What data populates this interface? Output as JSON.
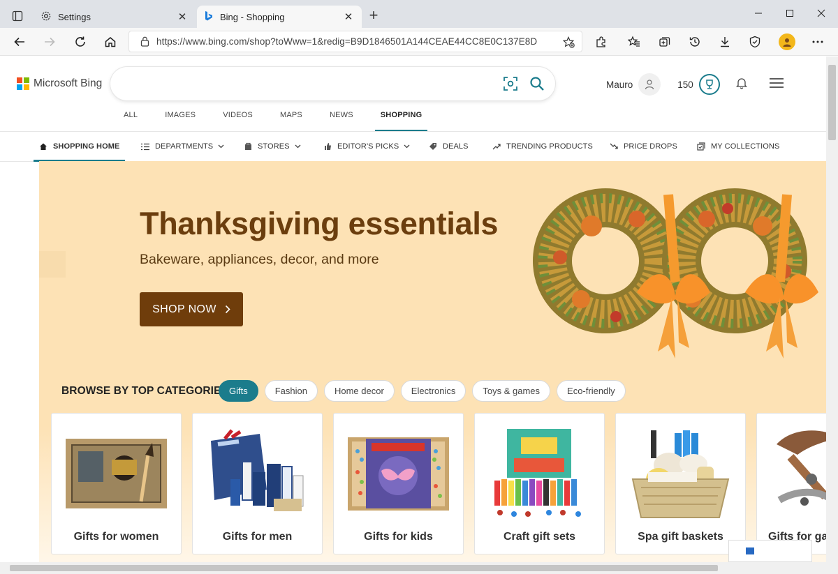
{
  "browser": {
    "tabs": [
      {
        "title": "Settings",
        "icon": "gear-icon"
      },
      {
        "title": "Bing - Shopping",
        "icon": "bing-icon"
      }
    ],
    "url": "https://www.bing.com/shop?toWww=1&redig=B9D1846501A144CEAE44CC8E0C137E8D"
  },
  "header": {
    "logo_text": "Microsoft Bing",
    "search_value": "",
    "user_name": "Mauro",
    "reward_points": "150"
  },
  "scopes": [
    "ALL",
    "IMAGES",
    "VIDEOS",
    "MAPS",
    "NEWS",
    "SHOPPING"
  ],
  "category_nav": [
    {
      "label": "SHOPPING HOME",
      "icon": "home-icon"
    },
    {
      "label": "DEPARTMENTS",
      "icon": "list-icon"
    },
    {
      "label": "STORES",
      "icon": "store-icon"
    },
    {
      "label": "EDITOR'S PICKS",
      "icon": "thumbs-up-icon"
    },
    {
      "label": "DEALS",
      "icon": "tag-icon"
    },
    {
      "label": "TRENDING PRODUCTS",
      "icon": "trending-icon"
    },
    {
      "label": "PRICE DROPS",
      "icon": "price-drop-icon"
    },
    {
      "label": "MY COLLECTIONS",
      "icon": "collections-icon"
    }
  ],
  "hero": {
    "title": "Thanksgiving essentials",
    "subtitle": "Bakeware, appliances, decor, and more",
    "cta_label": "SHOP NOW"
  },
  "browse": {
    "title": "BROWSE BY TOP CATEGORIES",
    "chips": [
      "Gifts",
      "Fashion",
      "Home decor",
      "Electronics",
      "Toys & games",
      "Eco-friendly"
    ],
    "cards": [
      "Gifts for women",
      "Gifts for men",
      "Gifts for kids",
      "Craft gift sets",
      "Spa gift baskets",
      "Gifts for ga"
    ]
  },
  "colors": {
    "accent": "#1b7c8c",
    "hero_bg": "#fde2b5",
    "hero_title": "#6b3e0e",
    "cta_bg": "#6f3d0b"
  }
}
